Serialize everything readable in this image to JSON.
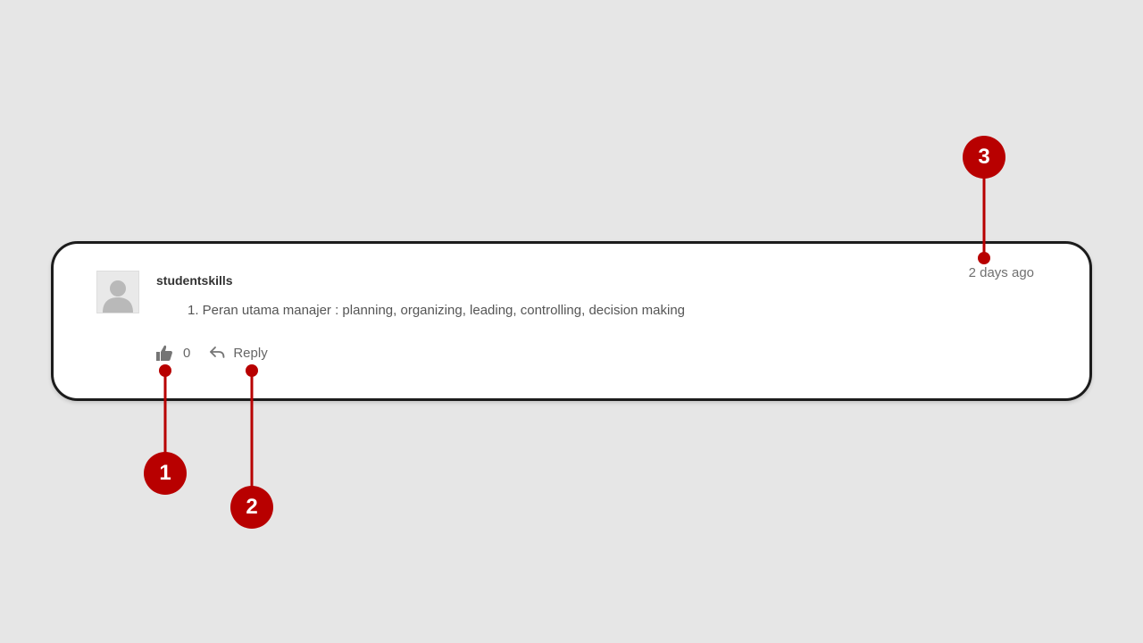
{
  "comment": {
    "username": "studentskills",
    "timestamp": "2 days ago",
    "body": "1. Peran utama manajer : planning, organizing, leading, controlling, decision making",
    "like_count": "0",
    "reply_label": "Reply"
  },
  "callouts": [
    {
      "number": "1",
      "target": "like-button"
    },
    {
      "number": "2",
      "target": "reply-button"
    },
    {
      "number": "3",
      "target": "timestamp"
    }
  ],
  "colors": {
    "callout": "#b80000",
    "background": "#e6e6e6",
    "card": "#ffffff",
    "card_border": "#1c1c1c"
  },
  "icons": {
    "avatar": "default-user-icon",
    "like": "thumbs-up-icon",
    "reply": "reply-arrow-icon"
  }
}
